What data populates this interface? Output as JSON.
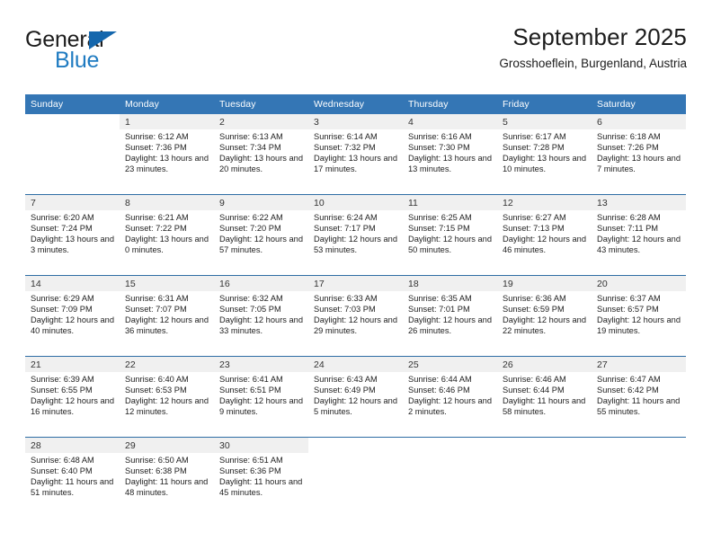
{
  "brand": {
    "name_primary": "General",
    "name_secondary": "Blue",
    "flag_icon": "triangle-flag-icon",
    "primary_color": "#1c1c1c",
    "accent_color": "#1f7bc1",
    "flag_color": "#1567ad"
  },
  "header": {
    "title": "September 2025",
    "subtitle": "Grosshoeflein, Burgenland, Austria"
  },
  "calendar": {
    "header_bg": "#3476b5",
    "header_text_color": "#ffffff",
    "daynum_bg": "#f0f0f0",
    "week_separator_color": "#2e6da4",
    "weekday_headers": [
      "Sunday",
      "Monday",
      "Tuesday",
      "Wednesday",
      "Thursday",
      "Friday",
      "Saturday"
    ],
    "weeks": [
      [
        {
          "empty": true
        },
        {
          "day": "1",
          "sunrise": "Sunrise: 6:12 AM",
          "sunset": "Sunset: 7:36 PM",
          "daylight": "Daylight: 13 hours and 23 minutes."
        },
        {
          "day": "2",
          "sunrise": "Sunrise: 6:13 AM",
          "sunset": "Sunset: 7:34 PM",
          "daylight": "Daylight: 13 hours and 20 minutes."
        },
        {
          "day": "3",
          "sunrise": "Sunrise: 6:14 AM",
          "sunset": "Sunset: 7:32 PM",
          "daylight": "Daylight: 13 hours and 17 minutes."
        },
        {
          "day": "4",
          "sunrise": "Sunrise: 6:16 AM",
          "sunset": "Sunset: 7:30 PM",
          "daylight": "Daylight: 13 hours and 13 minutes."
        },
        {
          "day": "5",
          "sunrise": "Sunrise: 6:17 AM",
          "sunset": "Sunset: 7:28 PM",
          "daylight": "Daylight: 13 hours and 10 minutes."
        },
        {
          "day": "6",
          "sunrise": "Sunrise: 6:18 AM",
          "sunset": "Sunset: 7:26 PM",
          "daylight": "Daylight: 13 hours and 7 minutes."
        }
      ],
      [
        {
          "day": "7",
          "sunrise": "Sunrise: 6:20 AM",
          "sunset": "Sunset: 7:24 PM",
          "daylight": "Daylight: 13 hours and 3 minutes."
        },
        {
          "day": "8",
          "sunrise": "Sunrise: 6:21 AM",
          "sunset": "Sunset: 7:22 PM",
          "daylight": "Daylight: 13 hours and 0 minutes."
        },
        {
          "day": "9",
          "sunrise": "Sunrise: 6:22 AM",
          "sunset": "Sunset: 7:20 PM",
          "daylight": "Daylight: 12 hours and 57 minutes."
        },
        {
          "day": "10",
          "sunrise": "Sunrise: 6:24 AM",
          "sunset": "Sunset: 7:17 PM",
          "daylight": "Daylight: 12 hours and 53 minutes."
        },
        {
          "day": "11",
          "sunrise": "Sunrise: 6:25 AM",
          "sunset": "Sunset: 7:15 PM",
          "daylight": "Daylight: 12 hours and 50 minutes."
        },
        {
          "day": "12",
          "sunrise": "Sunrise: 6:27 AM",
          "sunset": "Sunset: 7:13 PM",
          "daylight": "Daylight: 12 hours and 46 minutes."
        },
        {
          "day": "13",
          "sunrise": "Sunrise: 6:28 AM",
          "sunset": "Sunset: 7:11 PM",
          "daylight": "Daylight: 12 hours and 43 minutes."
        }
      ],
      [
        {
          "day": "14",
          "sunrise": "Sunrise: 6:29 AM",
          "sunset": "Sunset: 7:09 PM",
          "daylight": "Daylight: 12 hours and 40 minutes."
        },
        {
          "day": "15",
          "sunrise": "Sunrise: 6:31 AM",
          "sunset": "Sunset: 7:07 PM",
          "daylight": "Daylight: 12 hours and 36 minutes."
        },
        {
          "day": "16",
          "sunrise": "Sunrise: 6:32 AM",
          "sunset": "Sunset: 7:05 PM",
          "daylight": "Daylight: 12 hours and 33 minutes."
        },
        {
          "day": "17",
          "sunrise": "Sunrise: 6:33 AM",
          "sunset": "Sunset: 7:03 PM",
          "daylight": "Daylight: 12 hours and 29 minutes."
        },
        {
          "day": "18",
          "sunrise": "Sunrise: 6:35 AM",
          "sunset": "Sunset: 7:01 PM",
          "daylight": "Daylight: 12 hours and 26 minutes."
        },
        {
          "day": "19",
          "sunrise": "Sunrise: 6:36 AM",
          "sunset": "Sunset: 6:59 PM",
          "daylight": "Daylight: 12 hours and 22 minutes."
        },
        {
          "day": "20",
          "sunrise": "Sunrise: 6:37 AM",
          "sunset": "Sunset: 6:57 PM",
          "daylight": "Daylight: 12 hours and 19 minutes."
        }
      ],
      [
        {
          "day": "21",
          "sunrise": "Sunrise: 6:39 AM",
          "sunset": "Sunset: 6:55 PM",
          "daylight": "Daylight: 12 hours and 16 minutes."
        },
        {
          "day": "22",
          "sunrise": "Sunrise: 6:40 AM",
          "sunset": "Sunset: 6:53 PM",
          "daylight": "Daylight: 12 hours and 12 minutes."
        },
        {
          "day": "23",
          "sunrise": "Sunrise: 6:41 AM",
          "sunset": "Sunset: 6:51 PM",
          "daylight": "Daylight: 12 hours and 9 minutes."
        },
        {
          "day": "24",
          "sunrise": "Sunrise: 6:43 AM",
          "sunset": "Sunset: 6:49 PM",
          "daylight": "Daylight: 12 hours and 5 minutes."
        },
        {
          "day": "25",
          "sunrise": "Sunrise: 6:44 AM",
          "sunset": "Sunset: 6:46 PM",
          "daylight": "Daylight: 12 hours and 2 minutes."
        },
        {
          "day": "26",
          "sunrise": "Sunrise: 6:46 AM",
          "sunset": "Sunset: 6:44 PM",
          "daylight": "Daylight: 11 hours and 58 minutes."
        },
        {
          "day": "27",
          "sunrise": "Sunrise: 6:47 AM",
          "sunset": "Sunset: 6:42 PM",
          "daylight": "Daylight: 11 hours and 55 minutes."
        }
      ],
      [
        {
          "day": "28",
          "sunrise": "Sunrise: 6:48 AM",
          "sunset": "Sunset: 6:40 PM",
          "daylight": "Daylight: 11 hours and 51 minutes."
        },
        {
          "day": "29",
          "sunrise": "Sunrise: 6:50 AM",
          "sunset": "Sunset: 6:38 PM",
          "daylight": "Daylight: 11 hours and 48 minutes."
        },
        {
          "day": "30",
          "sunrise": "Sunrise: 6:51 AM",
          "sunset": "Sunset: 6:36 PM",
          "daylight": "Daylight: 11 hours and 45 minutes."
        },
        {
          "empty": true
        },
        {
          "empty": true
        },
        {
          "empty": true
        },
        {
          "empty": true
        }
      ]
    ]
  }
}
